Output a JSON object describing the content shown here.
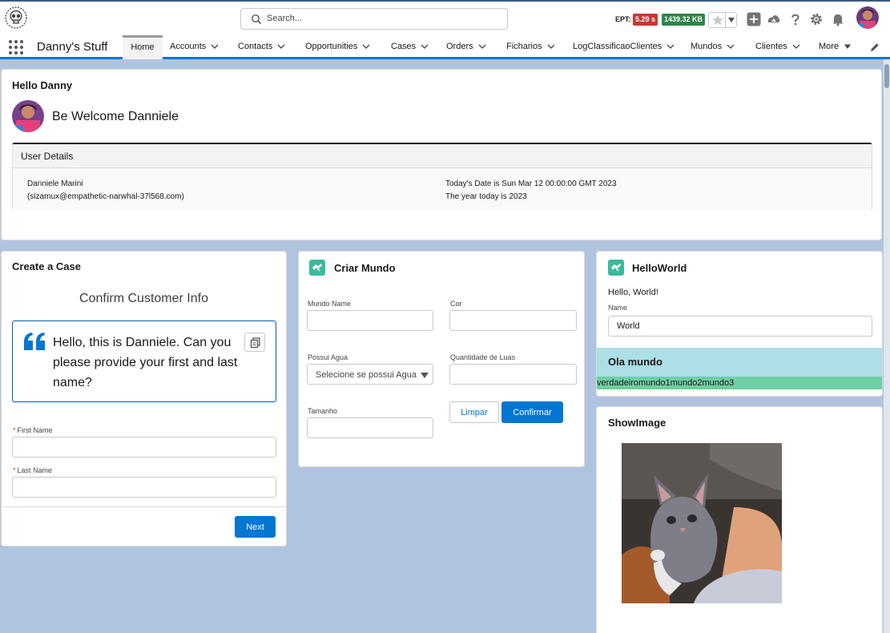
{
  "header": {
    "search_placeholder": "Search...",
    "ept_label": "EPT:",
    "ept_time": "5.29 s",
    "ept_size": "1439.32 KB",
    "icons": [
      "org-logo-skull-icon",
      "search-icon",
      "star-icon",
      "chevron-down-icon",
      "add-icon",
      "trailhead-icon",
      "help-icon",
      "gear-icon",
      "bell-icon",
      "user-avatar"
    ]
  },
  "nav": {
    "app_name": "Danny's Stuff",
    "items": [
      {
        "label": "Home",
        "active": true
      },
      {
        "label": "Accounts"
      },
      {
        "label": "Contacts"
      },
      {
        "label": "Opportunities"
      },
      {
        "label": "Cases"
      },
      {
        "label": "Orders"
      },
      {
        "label": "Ficharios"
      },
      {
        "label": "LogClassificaoClientes"
      },
      {
        "label": "Mundos"
      },
      {
        "label": "Clientes"
      },
      {
        "label": "More"
      }
    ]
  },
  "welcome": {
    "title": "Hello Danny",
    "message": "Be Welcome Danniele",
    "user_details": {
      "header": "User Details",
      "name": "Danniele Marini",
      "email": "(sizamux@empathetic-narwhal-37l568.com)",
      "date_line": "Today's Date is Sun Mar 12 00:00:00 GMT 2023",
      "year_line": "The year today is 2023"
    }
  },
  "create_case": {
    "title": "Create a Case",
    "subtitle": "Confirm Customer Info",
    "quote": "Hello, this is Danniele. Can you please provide your first and last name?",
    "first_name_label": "First Name",
    "last_name_label": "Last Name",
    "first_name_value": "",
    "last_name_value": "",
    "next_label": "Next"
  },
  "criar_mundo": {
    "title": "Criar Mundo",
    "mundo_name_label": "Mundo Name",
    "cor_label": "Cor",
    "possui_agua_label": "Possui Agua",
    "possui_agua_placeholder": "Selecione se possui Agua",
    "quantidade_luas_label": "Quantidade de Luas",
    "tamanho_label": "Tamanho",
    "limpar_label": "Limpar",
    "confirmar_label": "Confirmar"
  },
  "hello_world": {
    "title": "HelloWorld",
    "greeting": "Hello, World!",
    "name_label": "Name",
    "name_value": "World",
    "band_text": "Ola mundo",
    "green_text": "verdadeiromundo1mundo2mundo3"
  },
  "show_image": {
    "title": "ShowImage"
  },
  "colors": {
    "brand_blue": "#0176d3",
    "page_background": "#b0c4df",
    "ept_time_badge": "#c23934",
    "ept_size_badge": "#2e844a",
    "card_icon": "#3bba9c",
    "band_cyan": "#acdfe6",
    "band_green": "#6dcfa4"
  }
}
